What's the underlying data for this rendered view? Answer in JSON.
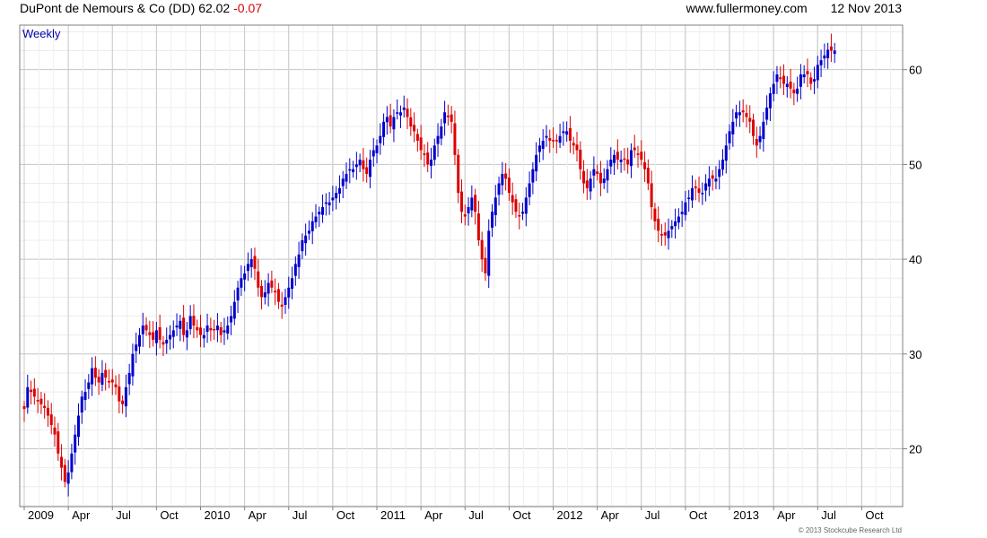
{
  "header": {
    "security": "DuPont de Nemours & Co (DD)",
    "last": "62.02",
    "change": "-0.07",
    "site": "www.fullermoney.com",
    "date": "12 Nov 2013"
  },
  "footer": "© 2013 Stockcube Research Ltd",
  "chart_data": {
    "type": "candlestick",
    "period_label": "Weekly",
    "colors": {
      "up": "#0000cc",
      "down": "#dd0000",
      "grid": "#d0d0d0",
      "frame": "#808080"
    },
    "y_ticks": [
      20,
      30,
      40,
      50,
      60
    ],
    "ylim": [
      13.9,
      64.7
    ],
    "x_ticks": [
      {
        "label": "2009",
        "week": 1
      },
      {
        "label": "Apr",
        "week": 14
      },
      {
        "label": "Jul",
        "week": 27
      },
      {
        "label": "Oct",
        "week": 40
      },
      {
        "label": "2010",
        "week": 53
      },
      {
        "label": "Apr",
        "week": 66
      },
      {
        "label": "Jul",
        "week": 79
      },
      {
        "label": "Oct",
        "week": 92
      },
      {
        "label": "2011",
        "week": 105
      },
      {
        "label": "Apr",
        "week": 118
      },
      {
        "label": "Jul",
        "week": 131
      },
      {
        "label": "Oct",
        "week": 144
      },
      {
        "label": "2012",
        "week": 157
      },
      {
        "label": "Apr",
        "week": 170
      },
      {
        "label": "Jul",
        "week": 183
      },
      {
        "label": "Oct",
        "week": 196
      },
      {
        "label": "2013",
        "week": 209
      },
      {
        "label": "Apr",
        "week": 222
      },
      {
        "label": "Jul",
        "week": 235
      },
      {
        "label": "Oct",
        "week": 248
      }
    ],
    "weeks": 259,
    "closes": [
      24.2,
      26.5,
      26,
      25.5,
      25,
      24.7,
      24.3,
      23.5,
      22.5,
      21.5,
      19.5,
      18,
      16.5,
      17.5,
      19.5,
      21.5,
      23.5,
      25.5,
      26,
      27,
      28.5,
      27.5,
      27,
      28,
      27.5,
      27,
      27,
      26.5,
      25,
      24.7,
      26.5,
      28,
      30,
      31,
      32,
      33,
      32.5,
      32,
      31.5,
      32.5,
      31.5,
      31,
      31.5,
      32,
      32.5,
      33,
      33.5,
      32,
      32.5,
      34,
      33,
      32.5,
      32,
      32,
      33,
      32.5,
      32.5,
      33,
      32,
      32.5,
      33,
      34,
      35.5,
      37,
      38,
      38.5,
      39.5,
      40,
      39,
      37,
      36,
      36.5,
      37.5,
      37,
      36.5,
      35.5,
      35,
      36,
      37,
      38,
      39.5,
      40.5,
      42,
      42.5,
      43,
      44,
      44.5,
      45,
      45.5,
      46,
      46,
      46.5,
      47,
      47.5,
      48.5,
      49,
      49.5,
      49.5,
      50,
      50.5,
      49.5,
      49,
      50.5,
      51.5,
      52,
      53,
      54.5,
      55,
      54,
      55,
      55.5,
      55.5,
      56,
      55,
      54,
      53.5,
      52.5,
      51.5,
      51,
      50,
      50.5,
      52,
      53,
      54,
      55.5,
      55,
      54.5,
      51,
      47,
      45,
      44.5,
      45.5,
      46.5,
      45,
      42,
      40,
      38.5,
      43,
      45,
      46.5,
      48,
      49,
      48.5,
      47,
      46,
      45,
      44.5,
      45,
      46.5,
      48,
      49.5,
      51,
      52,
      52.5,
      53,
      52.5,
      52.5,
      52.5,
      53,
      53.5,
      53.5,
      52.5,
      52,
      51.5,
      49.5,
      48,
      47.5,
      48.5,
      49.5,
      49,
      48,
      48.5,
      49.5,
      50.5,
      51,
      50.5,
      50.5,
      50.5,
      50,
      51.5,
      51.5,
      51,
      50.5,
      49.5,
      48,
      45.5,
      44,
      43,
      42.5,
      42.5,
      43,
      43.5,
      44,
      44.5,
      45,
      46,
      46.5,
      47.5,
      47.5,
      47,
      47,
      48,
      48.5,
      48.5,
      48.5,
      49.5,
      50.5,
      52,
      53.5,
      54.5,
      55.5,
      55.5,
      55.5,
      55,
      54.5,
      53,
      52,
      53,
      54.5,
      56,
      57.5,
      58.5,
      59.5,
      59,
      58.5,
      58.5,
      58,
      57.5,
      58,
      59.5,
      59.5,
      59.5,
      58.5,
      59,
      60.5,
      61,
      61.5,
      62.1,
      62,
      62.02
    ]
  }
}
